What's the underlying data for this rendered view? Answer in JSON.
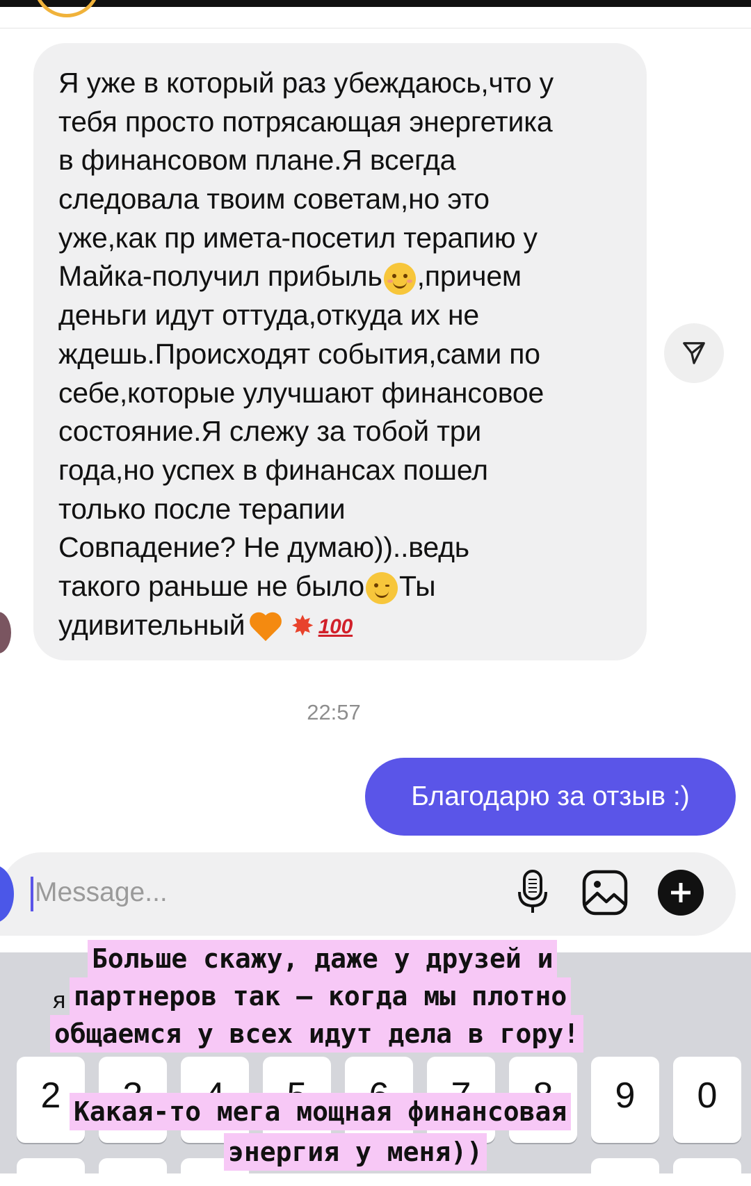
{
  "incoming_message": {
    "lines": [
      "Я уже в который раз убеждаюсь,что у",
      "тебя просто потрясающая энергетика",
      "в финансовом плане.Я всегда",
      "следовала твоим советам,но это",
      "уже,как пр имета-посетил терапию у",
      "деньги идут оттуда,откуда их не",
      "ждешь.Происходят события,сами по",
      "себе,которые улучшают финансовое",
      "состояние.Я слежу за тобой три",
      "года,но успех в финансах пошел",
      "только после терапии",
      "Совпадение? Не думаю))..ведь"
    ],
    "line6_before": "Майка-получил прибыль",
    "line6_after": ",причем",
    "line13_before": "такого раньше не было",
    "line13_after": "Ты",
    "line14": "удивительный",
    "hundred": "100"
  },
  "timestamp": "22:57",
  "outgoing_message": "Благодарю за отзыв :)",
  "composer": {
    "placeholder": "Message..."
  },
  "keyboard": {
    "keys": [
      "2",
      "3",
      "4",
      "5",
      "6",
      "7",
      "8",
      "9",
      "0"
    ]
  },
  "overlay": {
    "lines": [
      "Больше скажу, даже у друзей и",
      "партнеров так — когда мы плотно",
      "общаемся у всех идут дела в гору!",
      "Какая-то мега мощная финансовая",
      "энергия у меня))"
    ],
    "fragment": "я"
  },
  "colors": {
    "accent": "#5a55e8",
    "bubble_in": "#f0f0f1",
    "overlay_highlight": "#f7c8f6"
  },
  "icons": [
    "share-icon",
    "microphone-icon",
    "gallery-icon",
    "plus-icon",
    "camera-icon"
  ]
}
